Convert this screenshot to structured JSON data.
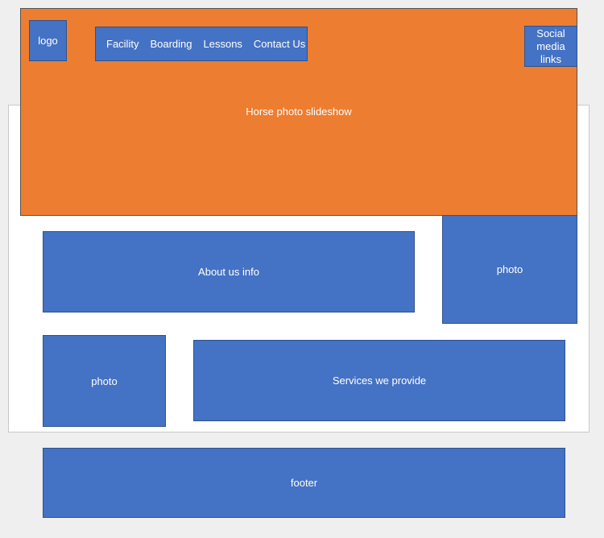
{
  "header": {
    "hero_label": "Horse photo slideshow",
    "logo_label": "logo",
    "nav_items": [
      "Facility",
      "Boarding",
      "Lessons",
      "Contact Us"
    ],
    "social_label": "Social media links"
  },
  "main": {
    "about_label": "About us info",
    "photo_right_label": "photo",
    "photo_left_label": "photo",
    "services_label": "Services we provide"
  },
  "footer": {
    "label": "footer"
  },
  "colors": {
    "page_background": "#efefef",
    "content_panel": "#ffffff",
    "hero_orange": "#ed7d31",
    "block_blue": "#4472c4",
    "block_border": "#2f528f",
    "text": "#ffffff"
  }
}
